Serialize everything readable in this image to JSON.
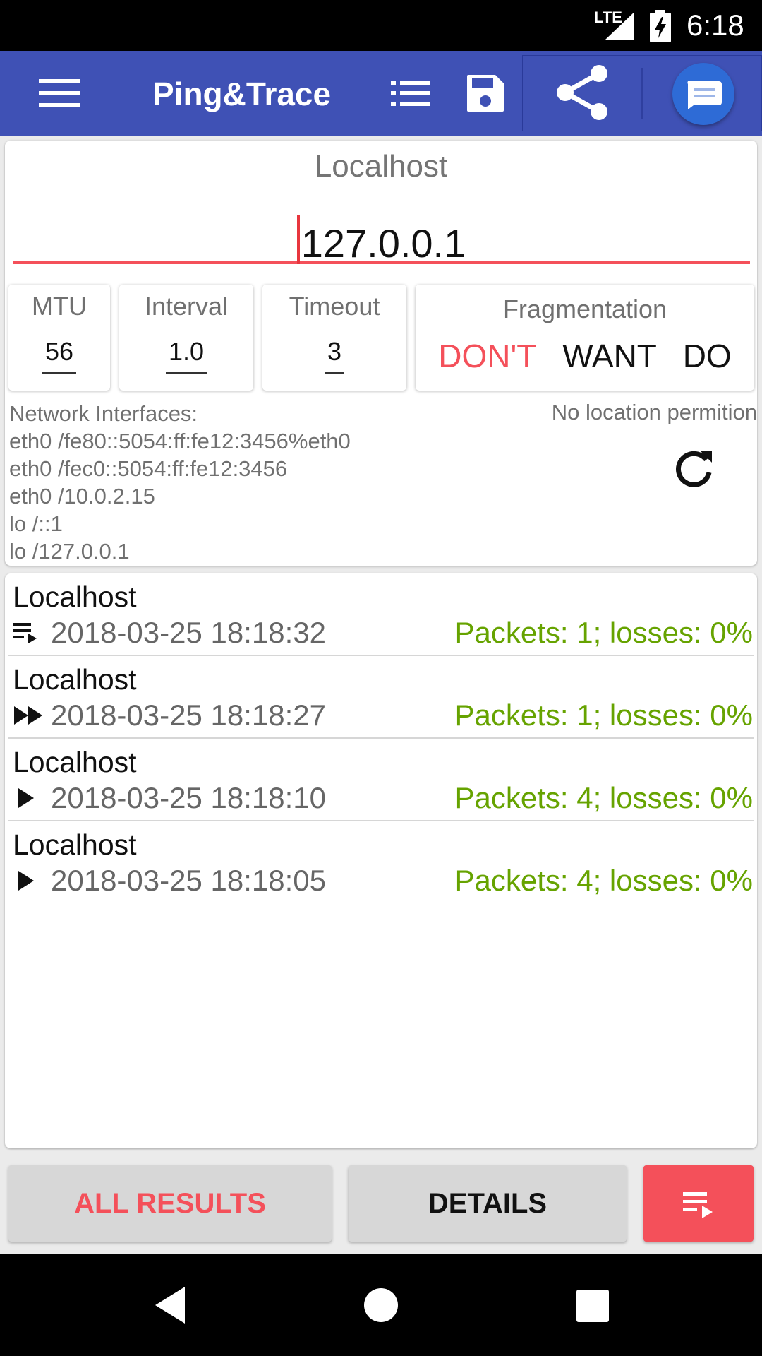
{
  "status_bar": {
    "network": "LTE",
    "time": "6:18"
  },
  "app_bar": {
    "title": "Ping&Trace"
  },
  "host": {
    "label": "Localhost",
    "address": "127.0.0.1"
  },
  "params": {
    "mtu": {
      "label": "MTU",
      "value": "56"
    },
    "interval": {
      "label": "Interval",
      "value": "1.0"
    },
    "timeout": {
      "label": "Timeout",
      "value": "3"
    },
    "fragmentation": {
      "label": "Fragmentation",
      "options": [
        "DON'T",
        "WANT",
        "DO"
      ],
      "selected": "DON'T"
    }
  },
  "network": {
    "label": "Network Interfaces:",
    "location_status": "No location permition",
    "interfaces": [
      "eth0 /fe80::5054:ff:fe12:3456%eth0",
      "eth0 /fec0::5054:ff:fe12:3456",
      "eth0 /10.0.2.15",
      "lo /::1",
      "lo /127.0.0.1"
    ]
  },
  "results": [
    {
      "name": "Localhost",
      "icon": "queue-icon",
      "timestamp": "2018-03-25 18:18:32",
      "stats": "Packets: 1; losses: 0%"
    },
    {
      "name": "Localhost",
      "icon": "fast-forward-icon",
      "timestamp": "2018-03-25 18:18:27",
      "stats": "Packets: 1; losses: 0%"
    },
    {
      "name": "Localhost",
      "icon": "play-icon",
      "timestamp": "2018-03-25 18:18:10",
      "stats": "Packets: 4; losses: 0%"
    },
    {
      "name": "Localhost",
      "icon": "play-icon",
      "timestamp": "2018-03-25 18:18:05",
      "stats": "Packets: 4; losses: 0%"
    }
  ],
  "buttons": {
    "all_results": "ALL RESULTS",
    "details": "DETAILS"
  },
  "colors": {
    "app_bar": "#3f51b5",
    "accent": "#f4505a",
    "stats_green": "#66a300"
  }
}
